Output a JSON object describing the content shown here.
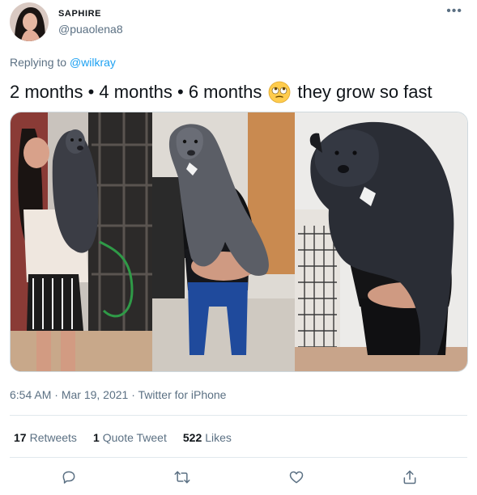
{
  "author": {
    "display_name": "SAPHIRE",
    "handle": "@puaolena8"
  },
  "reply": {
    "prefix": "Replying to",
    "mention": "@wilkray"
  },
  "tweet": {
    "text_before_emoji": "2 months • 4 months • 6 months",
    "emoji": "face-with-rolling-eyes-emoji",
    "text_after_emoji": "they grow so fast"
  },
  "media": {
    "images": [
      {
        "name": "photo-2-months"
      },
      {
        "name": "photo-4-months"
      },
      {
        "name": "photo-6-months"
      }
    ]
  },
  "meta": {
    "time": "6:54 AM",
    "separator": "·",
    "date": "Mar 19, 2021",
    "source": "Twitter for iPhone"
  },
  "stats": {
    "retweets_count": "17",
    "retweets_label": "Retweets",
    "quotes_count": "1",
    "quotes_label": "Quote Tweet",
    "likes_count": "522",
    "likes_label": "Likes"
  },
  "actions": [
    "reply-icon",
    "retweet-icon",
    "like-icon",
    "share-icon"
  ],
  "colors": {
    "link": "#1da1f2",
    "secondary_text": "#5b7083",
    "primary_text": "#0f1419",
    "divider": "#e1e8ed"
  }
}
